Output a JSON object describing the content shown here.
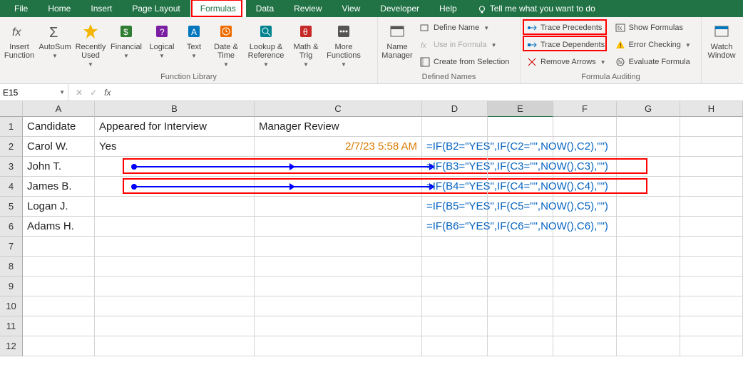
{
  "tabs": {
    "file": "File",
    "home": "Home",
    "insert": "Insert",
    "page_layout": "Page Layout",
    "formulas": "Formulas",
    "data": "Data",
    "review": "Review",
    "view": "View",
    "developer": "Developer",
    "help": "Help",
    "tell_me": "Tell me what you want to do"
  },
  "ribbon": {
    "function_library": {
      "label": "Function Library",
      "insert_function": "Insert Function",
      "autosum": "AutoSum",
      "recently_used": "Recently Used",
      "financial": "Financial",
      "logical": "Logical",
      "text": "Text",
      "date_time": "Date & Time",
      "lookup_ref": "Lookup & Reference",
      "math_trig": "Math & Trig",
      "more_functions": "More Functions"
    },
    "defined_names": {
      "label": "Defined Names",
      "name_manager": "Name Manager",
      "define_name": "Define Name",
      "use_in_formula": "Use in Formula",
      "create_from_selection": "Create from Selection"
    },
    "formula_auditing": {
      "label": "Formula Auditing",
      "trace_precedents": "Trace Precedents",
      "trace_dependents": "Trace Dependents",
      "remove_arrows": "Remove Arrows",
      "show_formulas": "Show Formulas",
      "error_checking": "Error Checking",
      "evaluate_formula": "Evaluate Formula",
      "watch_window": "Watch Window"
    }
  },
  "name_box": "E15",
  "columns": [
    "A",
    "B",
    "C",
    "D",
    "E",
    "F",
    "G",
    "H"
  ],
  "rows": [
    "1",
    "2",
    "3",
    "4",
    "5",
    "6",
    "7",
    "8",
    "9",
    "10",
    "11",
    "12"
  ],
  "data": {
    "A1": "Candidate",
    "B1": "Appeared for Interview",
    "C1": "Manager Review",
    "A2": "Carol W.",
    "B2": "Yes",
    "C2": "2/7/23 5:58 AM",
    "D2": "=IF(B2=\"YES\",IF(C2=\"\",NOW(),C2),\"\")",
    "A3": "John T.",
    "D3": "=IF(B3=\"YES\",IF(C3=\"\",NOW(),C3),\"\")",
    "A4": "James B.",
    "D4": "=IF(B4=\"YES\",IF(C4=\"\",NOW(),C4),\"\")",
    "A5": "Logan J.",
    "D5": "=IF(B5=\"YES\",IF(C5=\"\",NOW(),C5),\"\")",
    "A6": "Adams H.",
    "D6": "=IF(B6=\"YES\",IF(C6=\"\",NOW(),C6),\"\")"
  }
}
